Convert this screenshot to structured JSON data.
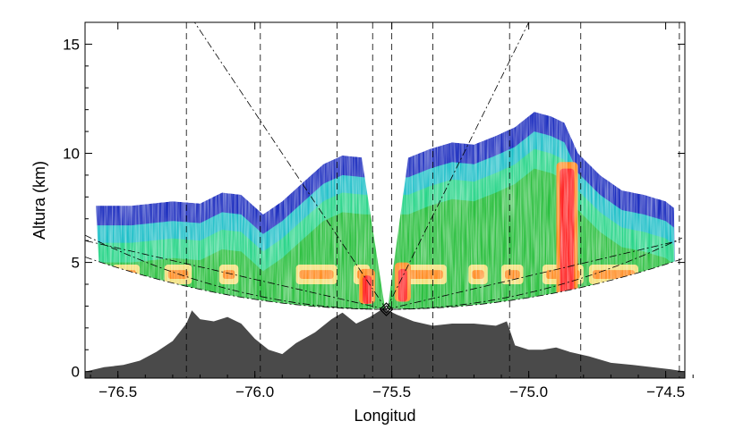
{
  "chart_data": {
    "type": "heatmap",
    "title": "",
    "xlabel": "Longitud",
    "ylabel": "Altura (km)",
    "xlim": [
      -76.62,
      -74.43
    ],
    "ylim": [
      -0.3,
      16
    ],
    "x_ticks": [
      {
        "value": -76.5,
        "label": "−76.5"
      },
      {
        "value": -76.0,
        "label": "−76.0"
      },
      {
        "value": -75.5,
        "label": "−75.5"
      },
      {
        "value": -75.0,
        "label": "−75.0"
      },
      {
        "value": -74.5,
        "label": "−74.5"
      }
    ],
    "y_ticks": [
      {
        "value": 0,
        "label": "0"
      },
      {
        "value": 5,
        "label": "5"
      },
      {
        "value": 10,
        "label": "10"
      },
      {
        "value": 15,
        "label": "15"
      }
    ],
    "grid": false,
    "radar_site": {
      "lon": -75.52,
      "alt_km": 2.85
    },
    "colors": {
      "weak": "#2bbf3f",
      "light": "#2bd58a",
      "moderate": "#1fbfc8",
      "cloud_top": "#1f2fbf",
      "bright_band": "#f2e07a",
      "strong": "#ff8a1f",
      "core": "#ff2020",
      "terrain": "#4a4a4a"
    },
    "echo_top_km": [
      [
        -76.58,
        7.6
      ],
      [
        -76.45,
        7.6
      ],
      [
        -76.3,
        7.8
      ],
      [
        -76.2,
        7.7
      ],
      [
        -76.12,
        8.2
      ],
      [
        -76.05,
        8.1
      ],
      [
        -75.97,
        7.2
      ],
      [
        -75.9,
        7.8
      ],
      [
        -75.83,
        8.6
      ],
      [
        -75.75,
        9.5
      ],
      [
        -75.68,
        9.9
      ],
      [
        -75.6,
        9.8
      ],
      [
        -75.44,
        9.8
      ],
      [
        -75.36,
        10.2
      ],
      [
        -75.28,
        10.5
      ],
      [
        -75.2,
        10.4
      ],
      [
        -75.12,
        10.8
      ],
      [
        -75.05,
        11.2
      ],
      [
        -74.98,
        11.9
      ],
      [
        -74.92,
        11.7
      ],
      [
        -74.87,
        11.4
      ],
      [
        -74.82,
        10.0
      ],
      [
        -74.74,
        9.0
      ],
      [
        -74.66,
        8.3
      ],
      [
        -74.58,
        8.1
      ],
      [
        -74.5,
        7.8
      ],
      [
        -74.46,
        7.4
      ]
    ],
    "bright_band_km": [
      4.0,
      4.9
    ],
    "bright_band_segments_lon": [
      [
        -76.52,
        -76.42
      ],
      [
        -76.33,
        -76.23
      ],
      [
        -76.13,
        -76.06
      ],
      [
        -75.85,
        -75.7
      ],
      [
        -75.64,
        -75.58
      ],
      [
        -75.48,
        -75.3
      ],
      [
        -75.22,
        -75.15
      ],
      [
        -75.1,
        -75.02
      ],
      [
        -74.95,
        -74.8
      ],
      [
        -74.78,
        -74.6
      ]
    ],
    "convective_cores": [
      {
        "lon": -74.86,
        "alt_range_km": [
          3.3,
          9.6
        ],
        "max": "core"
      },
      {
        "lon": -75.46,
        "alt_range_km": [
          3.2,
          5.0
        ],
        "max": "core"
      },
      {
        "lon": -75.59,
        "alt_range_km": [
          3.1,
          4.7
        ],
        "max": "core"
      }
    ],
    "reference_lines": {
      "vertical_lon": [
        -76.62,
        -76.25,
        -75.98,
        -75.7,
        -75.57,
        -75.5,
        -75.35,
        -75.07,
        -74.81,
        -74.45
      ],
      "ray_endpoints": [
        [
          -76.22,
          16.0
        ],
        [
          -75.0,
          16.0
        ],
        [
          -76.62,
          6.0
        ],
        [
          -74.45,
          6.0
        ]
      ]
    },
    "terrain_profile_km": [
      [
        -76.62,
        0.0
      ],
      [
        -76.55,
        0.2
      ],
      [
        -76.48,
        0.3
      ],
      [
        -76.42,
        0.5
      ],
      [
        -76.36,
        0.9
      ],
      [
        -76.3,
        1.4
      ],
      [
        -76.25,
        2.2
      ],
      [
        -76.23,
        2.8
      ],
      [
        -76.2,
        2.4
      ],
      [
        -76.15,
        2.3
      ],
      [
        -76.1,
        2.5
      ],
      [
        -76.05,
        2.2
      ],
      [
        -76.0,
        1.5
      ],
      [
        -75.95,
        1.0
      ],
      [
        -75.9,
        0.8
      ],
      [
        -75.85,
        1.3
      ],
      [
        -75.78,
        1.8
      ],
      [
        -75.72,
        2.4
      ],
      [
        -75.68,
        2.7
      ],
      [
        -75.63,
        2.2
      ],
      [
        -75.58,
        2.5
      ],
      [
        -75.53,
        2.9
      ],
      [
        -75.48,
        2.6
      ],
      [
        -75.42,
        2.3
      ],
      [
        -75.35,
        2.1
      ],
      [
        -75.28,
        2.2
      ],
      [
        -75.2,
        2.2
      ],
      [
        -75.12,
        2.1
      ],
      [
        -75.08,
        2.3
      ],
      [
        -75.05,
        1.2
      ],
      [
        -75.0,
        1.0
      ],
      [
        -74.95,
        1.0
      ],
      [
        -74.9,
        1.1
      ],
      [
        -74.85,
        0.9
      ],
      [
        -74.78,
        0.7
      ],
      [
        -74.7,
        0.4
      ],
      [
        -74.62,
        0.3
      ],
      [
        -74.55,
        0.2
      ],
      [
        -74.48,
        0.1
      ],
      [
        -74.43,
        0.0
      ]
    ]
  }
}
